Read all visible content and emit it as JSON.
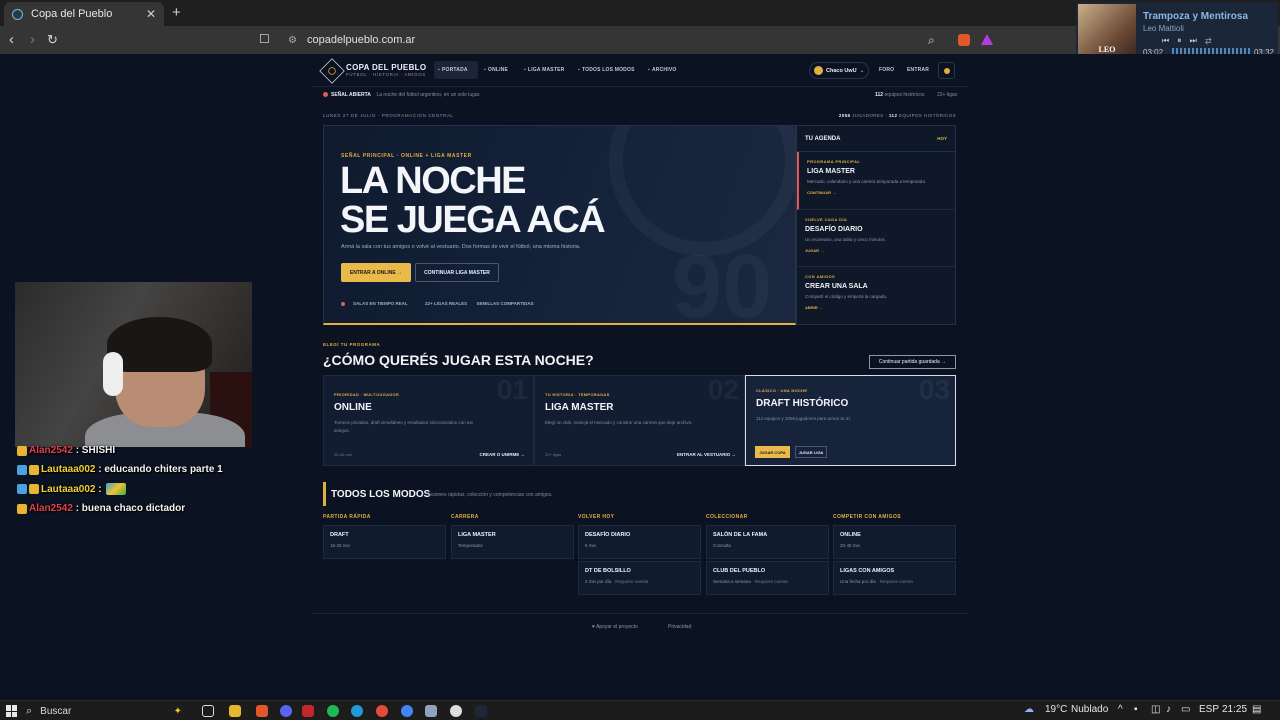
{
  "browser": {
    "tab_title": "Copa del Pueblo",
    "url": "copadelpueblo.com.ar"
  },
  "music": {
    "title": "Trampoza y Mentirosa",
    "artist": "Leo Mattioli",
    "art_label": "LEO MATTIOLI",
    "elapsed": "03:02",
    "duration": "03:32"
  },
  "nav": {
    "brand": "COPA DEL PUEBLO",
    "brand_sub": "FÚTBOL · HISTORIA · AMIGOS",
    "links": [
      "PORTADA",
      "ONLINE",
      "LIGA MASTER",
      "TODOS LOS MODOS",
      "ARCHIVO"
    ],
    "user": "Chaco UwU",
    "foro": "FORO",
    "entrar": "ENTRAR"
  },
  "ticker": {
    "live": "SEÑAL ABIERTA",
    "live_desc": "La noche del fútbol argentino, en un solo lugar.",
    "teams_count": "112",
    "teams_label": "equipos históricos",
    "leagues": "22+ ligas"
  },
  "dateline": {
    "left": "LUNES 27 DE JULIO · PROGRAMACIÓN CENTRAL",
    "players": "2058",
    "players_label": "JUGADORES ·",
    "teams": "112",
    "teams_label": "EQUIPOS HISTÓRICOS"
  },
  "hero": {
    "kicker": "SEÑAL PRINCIPAL · ONLINE + LIGA MASTER",
    "title_line1": "LA NOCHE",
    "title_line2": "SE JUEGA ACÁ",
    "lead": "Armá la sala con tus amigos o volvé al vestuario. Dos formas de vivir el fútbol, una misma historia.",
    "cta_primary": "ENTRAR A ONLINE →",
    "cta_secondary": "CONTINUAR LIGA MASTER",
    "features": [
      "SALAS EN TIEMPO REAL",
      "22+ LIGAS REALES",
      "SEMILLAS COMPARTIDAS"
    ],
    "bg_number": "90"
  },
  "agenda": {
    "title": "TU AGENDA",
    "tag": "HOY",
    "items": [
      {
        "kicker": "PROGRAMA PRINCIPAL",
        "name": "LIGA MASTER",
        "desc": "Mercado, calendario y una carrera temporada a temporada.",
        "link": "CONTINUAR →"
      },
      {
        "kicker": "VUELVE CADA DÍA",
        "name": "DESAFÍO DIARIO",
        "desc": "Un escenario, una tabla y cinco minutos.",
        "link": "JUGAR →"
      },
      {
        "kicker": "CON AMIGOS",
        "name": "CREAR UNA SALA",
        "desc": "Compartí el código y empezá la cargada.",
        "link": "ABRIR →"
      }
    ]
  },
  "programs": {
    "kicker": "ELEGÍ TU PROGRAMA",
    "title": "¿CÓMO QUERÉS JUGAR ESTA NOCHE?",
    "continue_btn": "Continuar partida guardada →",
    "cards": [
      {
        "num": "01",
        "kicker": "PRIORIDAD · MULTIJUGADOR",
        "name": "ONLINE",
        "desc": "Torneos privados, draft simultáneo y resultados sincronizados con tus amigos.",
        "foot_left": "20-40 min",
        "foot_right": "CREAR O UNIRME →"
      },
      {
        "num": "02",
        "kicker": "TU HISTORIA · TEMPORADAS",
        "name": "LIGA MASTER",
        "desc": "Elegí un club, manejá el mercado y construí una carrera que deje archivo.",
        "foot_left": "22+ ligas",
        "foot_right": "ENTRAR AL VESTUARIO →"
      },
      {
        "num": "03",
        "kicker": "CLÁSICO · UNA NOCHE",
        "name": "DRAFT HISTÓRICO",
        "desc": "112 equipos y 2058 jugadores para armar tu XI.",
        "btn1": "JUGAR COPA",
        "btn2": "JUGAR LIGA"
      }
    ]
  },
  "modes": {
    "title": "TODOS LOS MODOS",
    "subtitle": "Sesiones rápidas, colección y competencias con amigos.",
    "columns": [
      {
        "header": "PARTIDA RÁPIDA",
        "items": [
          {
            "name": "DRAFT",
            "desc": "15-25 min",
            "extra": ""
          }
        ]
      },
      {
        "header": "CARRERA",
        "items": [
          {
            "name": "LIGA MASTER",
            "desc": "Temporadas",
            "extra": ""
          }
        ]
      },
      {
        "header": "VOLVER HOY",
        "items": [
          {
            "name": "DESAFÍO DIARIO",
            "desc": "5 min",
            "extra": ""
          },
          {
            "name": "DT DE BOLSILLO",
            "desc": "2 min por día",
            "extra": "Requiere cuenta"
          }
        ]
      },
      {
        "header": "COLECCIONAR",
        "items": [
          {
            "name": "SALÓN DE LA FAMA",
            "desc": "Consulta",
            "extra": ""
          },
          {
            "name": "CLUB DEL PUEBLO",
            "desc": "Semana a semana",
            "extra": "Requiere cuenta"
          }
        ]
      },
      {
        "header": "COMPETIR CON AMIGOS",
        "items": [
          {
            "name": "ONLINE",
            "desc": "20-40 min",
            "extra": ""
          },
          {
            "name": "LIGAS CON AMIGOS",
            "desc": "Una fecha por día",
            "extra": "Requiere cuenta"
          }
        ]
      }
    ]
  },
  "footer": {
    "support": "Apoyar el proyecto",
    "privacy": "Privacidad"
  },
  "chat": [
    {
      "user": "Alan2542",
      "msg": ": SHISHI",
      "badges": [
        "yellow"
      ],
      "color": "red"
    },
    {
      "user": "Lautaaa002",
      "msg": ": educando chiters parte 1",
      "badges": [
        "blue",
        "yellow"
      ],
      "color": "yellow"
    },
    {
      "user": "Lautaaa002",
      "msg": ":",
      "badges": [
        "blue",
        "yellow"
      ],
      "color": "yellow",
      "emote": "rainbow-emote"
    },
    {
      "user": "Alan2542",
      "msg": ": buena chaco dictador",
      "badges": [
        "yellow"
      ],
      "color": "red"
    }
  ],
  "taskbar": {
    "search_placeholder": "Buscar",
    "weather": "19°C",
    "weather_desc": "Nublado",
    "lang": "ESP",
    "time": "21:25"
  },
  "colors": {
    "accent": "#e2b040",
    "bg": "#0b1221",
    "live": "#e05a5a"
  }
}
